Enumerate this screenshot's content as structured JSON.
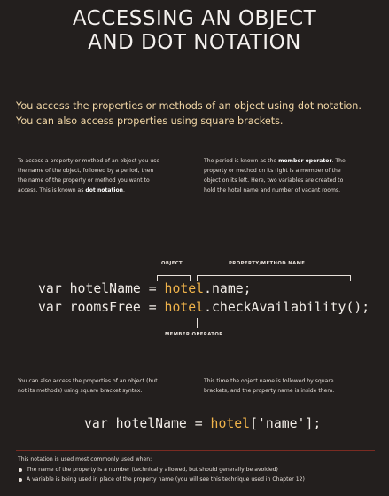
{
  "title": {
    "line1": "ACCESSING AN OBJECT",
    "line2": "AND DOT NOTATION"
  },
  "intro": {
    "line1": "You access the properties or methods of an object using dot notation.",
    "line2": "You can also access properties using square brackets."
  },
  "section1": {
    "left": {
      "line1": "To access a property or method of an object you use",
      "line2": "the name of the object, followed by a period, then",
      "line3": "the name of the property or method you want to",
      "line4_pre": "access. This is known as ",
      "line4_bold": "dot notation",
      "line4_post": "."
    },
    "right": {
      "line1_pre": "The period is known as the ",
      "line1_bold": "member operator",
      "line1_post": ". The",
      "line2": "property or method on its right is a member of the",
      "line3": "object on its left. Here, two variables are created to",
      "line4": "hold the hotel name and number of vacant rooms."
    }
  },
  "diagram": {
    "label_object": "OBJECT",
    "label_property": "PROPERTY/METHOD NAME",
    "label_member": "MEMBER OPERATOR",
    "code1_pre": "var hotelName = ",
    "code1_obj": "hotel",
    "code1_post": ".name;",
    "code2_pre": "var roomsFree = ",
    "code2_obj": "hotel",
    "code2_post": ".checkAvailability();"
  },
  "section2": {
    "left": {
      "line1": "You can also access the properties of an object (but",
      "line2": "not its methods) using square bracket syntax."
    },
    "right": {
      "line1": "This time the object name is followed by square",
      "line2": "brackets, and the property name is inside them."
    }
  },
  "code3": {
    "pre": "var hotelName = ",
    "obj": "hotel",
    "post": "['name'];"
  },
  "notes": {
    "intro": "This notation is used most commonly used when:",
    "bullets": [
      "The name of the property is a number (technically allowed, but should generally be avoided)",
      "A variable is being used in place of the property name (you will see this technique used in Chapter 12)"
    ]
  }
}
